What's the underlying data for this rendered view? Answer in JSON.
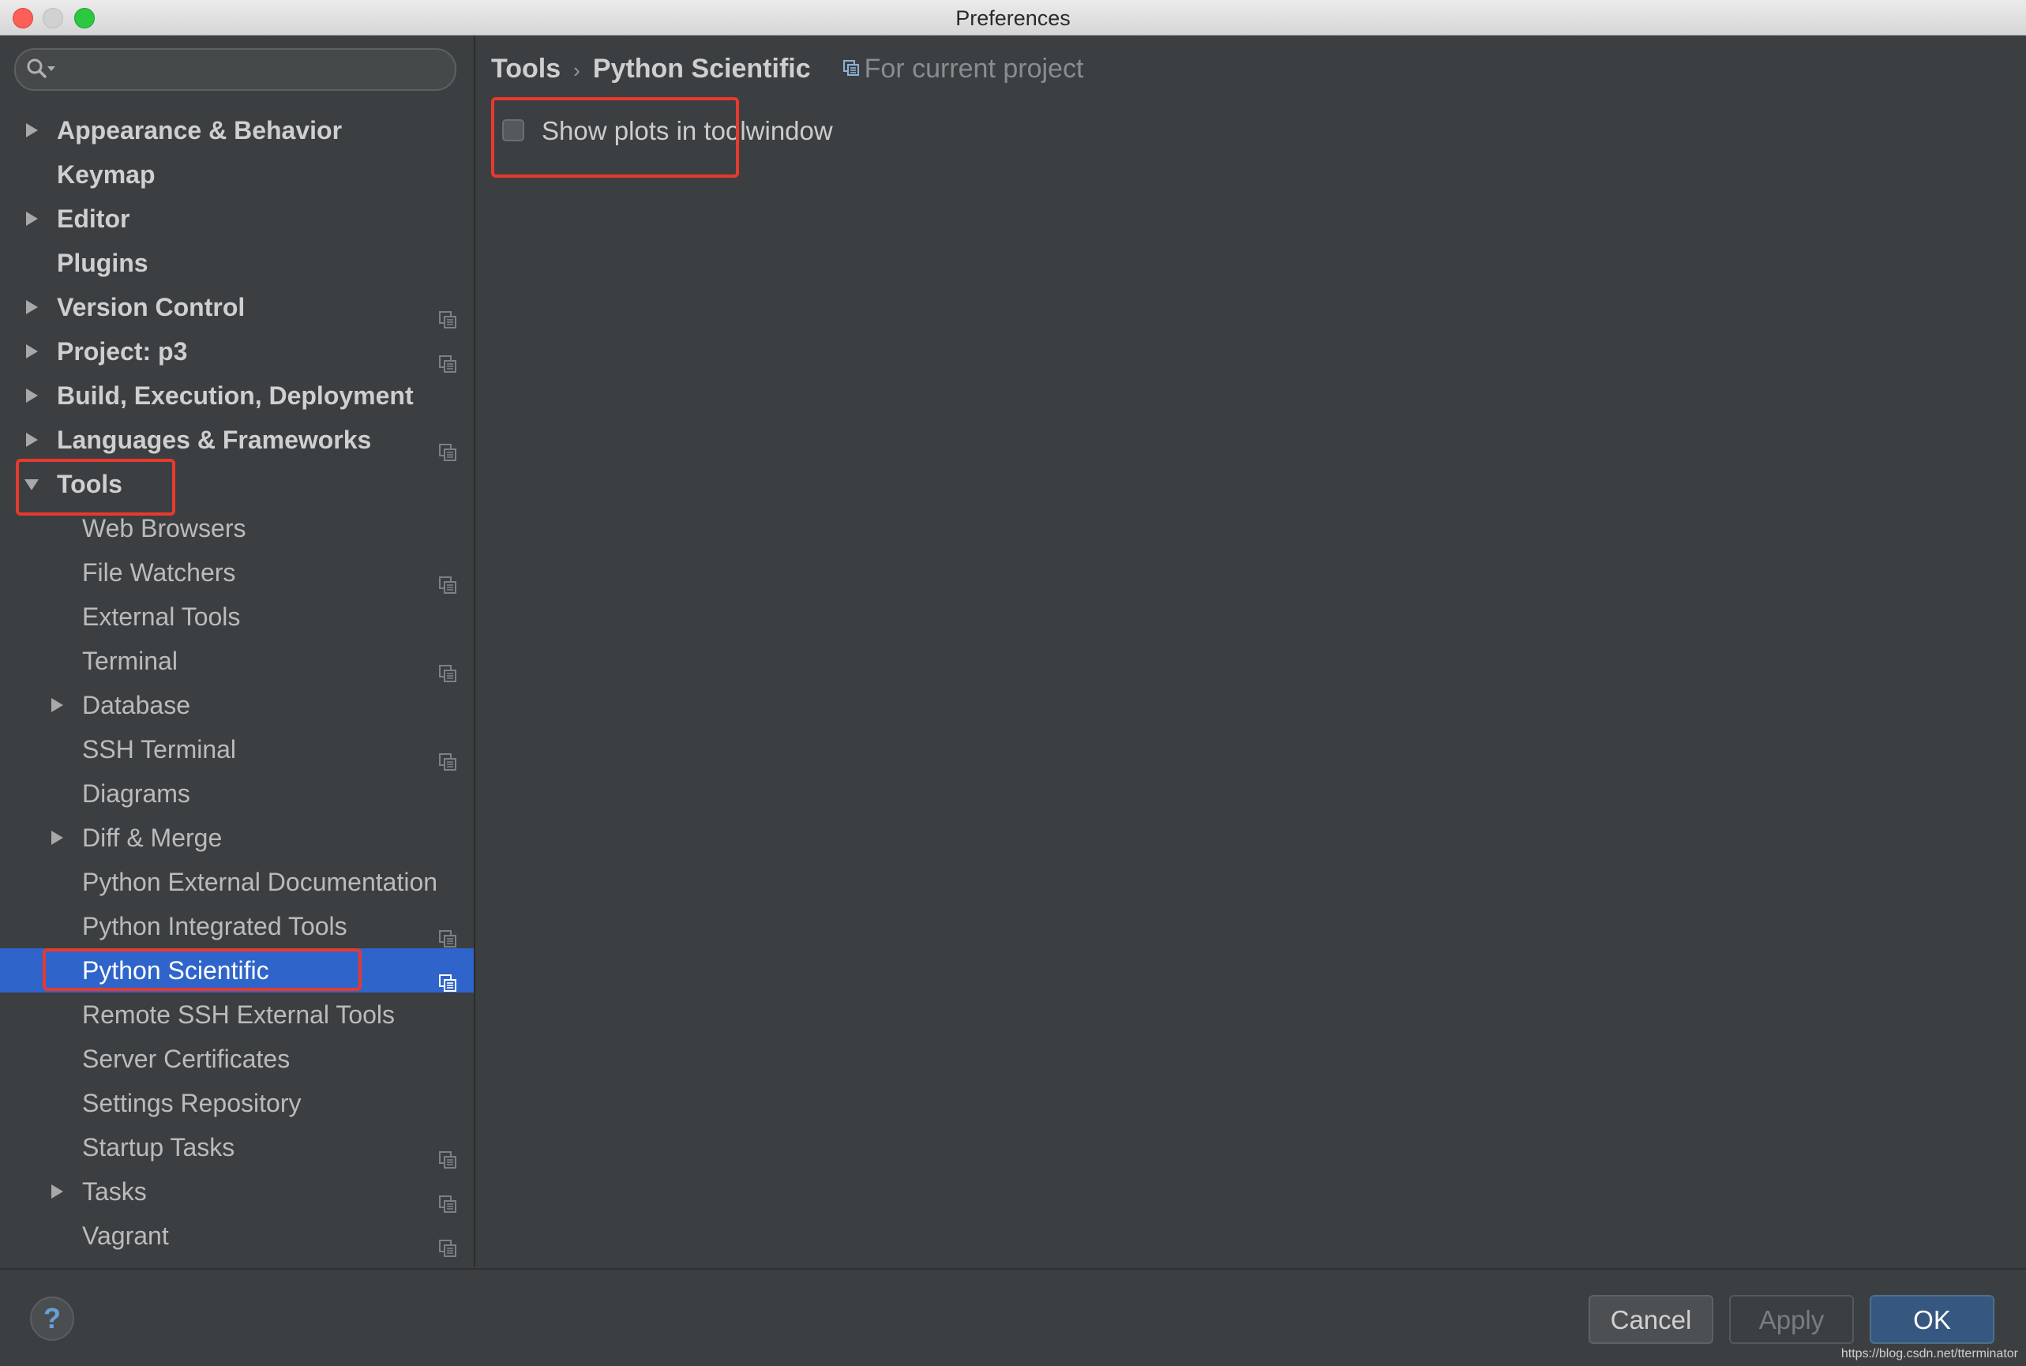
{
  "window": {
    "title": "Preferences"
  },
  "sidebar": {
    "search": {
      "value": "",
      "placeholder": ""
    },
    "items": [
      {
        "label": "Appearance & Behavior",
        "level": 0,
        "expandable": true,
        "expanded": false,
        "bold": true,
        "project_icon": false
      },
      {
        "label": "Keymap",
        "level": 0,
        "expandable": false,
        "bold": true,
        "project_icon": false
      },
      {
        "label": "Editor",
        "level": 0,
        "expandable": true,
        "expanded": false,
        "bold": true,
        "project_icon": false
      },
      {
        "label": "Plugins",
        "level": 0,
        "expandable": false,
        "bold": true,
        "project_icon": false
      },
      {
        "label": "Version Control",
        "level": 0,
        "expandable": true,
        "expanded": false,
        "bold": true,
        "project_icon": true
      },
      {
        "label": "Project: p3",
        "level": 0,
        "expandable": true,
        "expanded": false,
        "bold": true,
        "project_icon": true
      },
      {
        "label": "Build, Execution, Deployment",
        "level": 0,
        "expandable": true,
        "expanded": false,
        "bold": true,
        "project_icon": false
      },
      {
        "label": "Languages & Frameworks",
        "level": 0,
        "expandable": true,
        "expanded": false,
        "bold": true,
        "project_icon": true
      },
      {
        "label": "Tools",
        "level": 0,
        "expandable": true,
        "expanded": true,
        "bold": true,
        "project_icon": false,
        "highlighted": true
      },
      {
        "label": "Web Browsers",
        "level": 1,
        "expandable": false,
        "project_icon": false
      },
      {
        "label": "File Watchers",
        "level": 1,
        "expandable": false,
        "project_icon": true
      },
      {
        "label": "External Tools",
        "level": 1,
        "expandable": false,
        "project_icon": false
      },
      {
        "label": "Terminal",
        "level": 1,
        "expandable": false,
        "project_icon": true
      },
      {
        "label": "Database",
        "level": 1,
        "expandable": true,
        "expanded": false,
        "project_icon": false
      },
      {
        "label": "SSH Terminal",
        "level": 1,
        "expandable": false,
        "project_icon": true
      },
      {
        "label": "Diagrams",
        "level": 1,
        "expandable": false,
        "project_icon": false
      },
      {
        "label": "Diff & Merge",
        "level": 1,
        "expandable": true,
        "expanded": false,
        "project_icon": false
      },
      {
        "label": "Python External Documentation",
        "level": 1,
        "expandable": false,
        "project_icon": false
      },
      {
        "label": "Python Integrated Tools",
        "level": 1,
        "expandable": false,
        "project_icon": true
      },
      {
        "label": "Python Scientific",
        "level": 1,
        "expandable": false,
        "project_icon": true,
        "selected": true,
        "highlighted": true
      },
      {
        "label": "Remote SSH External Tools",
        "level": 1,
        "expandable": false,
        "project_icon": false
      },
      {
        "label": "Server Certificates",
        "level": 1,
        "expandable": false,
        "project_icon": false
      },
      {
        "label": "Settings Repository",
        "level": 1,
        "expandable": false,
        "project_icon": false
      },
      {
        "label": "Startup Tasks",
        "level": 1,
        "expandable": false,
        "project_icon": true
      },
      {
        "label": "Tasks",
        "level": 1,
        "expandable": true,
        "expanded": false,
        "project_icon": true
      },
      {
        "label": "Vagrant",
        "level": 1,
        "expandable": false,
        "project_icon": true
      }
    ]
  },
  "main": {
    "breadcrumb": [
      "Tools",
      "Python Scientific"
    ],
    "scope_label": "For current project",
    "options": [
      {
        "label": "Show plots in toolwindow",
        "checked": false
      }
    ]
  },
  "footer": {
    "help_label": "?",
    "cancel_label": "Cancel",
    "apply_label": "Apply",
    "ok_label": "OK"
  },
  "watermark": "https://blog.csdn.net/tterminator",
  "colors": {
    "selection": "#2f65ca",
    "highlight_box": "#e8392e",
    "ok_button": "#365880"
  }
}
